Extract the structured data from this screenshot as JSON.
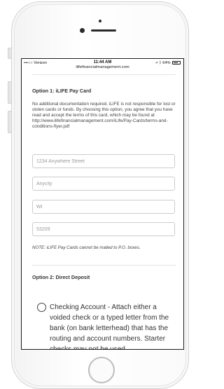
{
  "status_bar": {
    "carrier": "•••○○ Verizon",
    "time": "11:44 AM",
    "battery": "64%",
    "url": "ilifefinancialmanagement.com"
  },
  "option1": {
    "heading": "Option 1: iLIFE Pay Card",
    "description": "No additional documentation required. iLIFE is not responsible for lost or stolen cards or funds. By choosing this option, you agree that you have read and accept the terms of this card, which may be found at http://www.ilifefinancialmanagement.com/iLife/Pay-Cards/terms-and-conditions-flyer.pdf",
    "fields": {
      "street_placeholder": "1234 Anywhere Street",
      "city_placeholder": "Anycity",
      "state_placeholder": "WI",
      "zip_placeholder": "53209"
    },
    "note": "NOTE: iLIFE Pay Cards cannot be mailed to P.O. boxes."
  },
  "option2": {
    "heading": "Option 2: Direct Deposit",
    "checking_label": "Checking Account - Attach either a voided check or a typed letter from the bank (on bank letterhead) that has the routing and account numbers. Starter checks may not be used."
  }
}
